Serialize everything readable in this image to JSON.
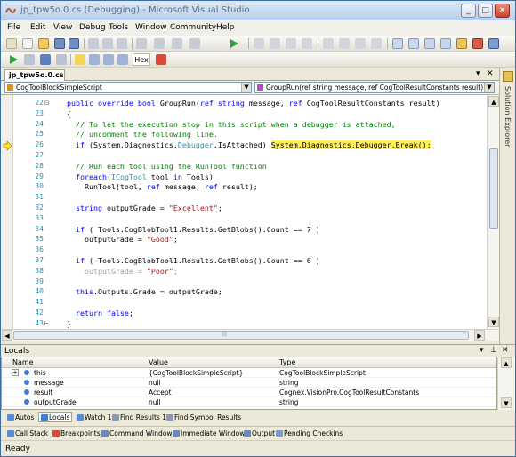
{
  "window": {
    "title": "jp_tpw5o.0.cs (Debugging) - Microsoft Visual Studio",
    "controls": {
      "minimize": "_",
      "maximize": "□",
      "close": "✕"
    }
  },
  "menu": [
    "File",
    "Edit",
    "View",
    "Debug",
    "Tools",
    "Window",
    "Community",
    "Help"
  ],
  "debug_toolbar": {
    "hex_label": "Hex"
  },
  "editor": {
    "tab_label": "jp_tpw5o.0.cs",
    "tab_controls": {
      "pin": "▾",
      "close": "✕"
    },
    "class_combo": "CogToolBlockSimpleScript",
    "member_combo": "GroupRun(ref string message, ref CogToolResultConstants result)",
    "lines": [
      {
        "num": "22",
        "fold": "⊟",
        "tokens": [
          [
            "",
            "  "
          ],
          [
            "kw",
            "public override bool "
          ],
          [
            "",
            "GroupRun("
          ],
          [
            "kw",
            "ref string "
          ],
          [
            "",
            "message, "
          ],
          [
            "kw",
            "ref "
          ],
          [
            "",
            "CogToolResultConstants result)"
          ]
        ]
      },
      {
        "num": "23",
        "fold": "",
        "tokens": [
          [
            "",
            "  {"
          ]
        ]
      },
      {
        "num": "24",
        "fold": "",
        "tokens": [
          [
            "cm",
            "    // To let the execution stop in this script when a debugger is attached,"
          ]
        ]
      },
      {
        "num": "25",
        "fold": "",
        "tokens": [
          [
            "cm",
            "    // uncomment the following line."
          ]
        ]
      },
      {
        "num": "26",
        "fold": "",
        "tokens": [
          [
            "kw",
            "    if "
          ],
          [
            "",
            "(System.Diagnostics."
          ],
          [
            "ty",
            "Debugger"
          ],
          [
            "",
            ".IsAttached) "
          ],
          [
            "hl",
            "System.Diagnostics.Debugger.Break();"
          ]
        ]
      },
      {
        "num": "27",
        "fold": "",
        "tokens": [
          [
            "",
            ""
          ]
        ]
      },
      {
        "num": "28",
        "fold": "",
        "tokens": [
          [
            "cm",
            "    // Run each tool using the RunTool function"
          ]
        ]
      },
      {
        "num": "29",
        "fold": "",
        "tokens": [
          [
            "kw",
            "    foreach"
          ],
          [
            "",
            "("
          ],
          [
            "ty",
            "ICogTool "
          ],
          [
            "",
            "tool "
          ],
          [
            "kw",
            "in "
          ],
          [
            "",
            "Tools)"
          ]
        ]
      },
      {
        "num": "30",
        "fold": "",
        "tokens": [
          [
            "",
            "      RunTool(tool, "
          ],
          [
            "kw",
            "ref "
          ],
          [
            "",
            "message, "
          ],
          [
            "kw",
            "ref "
          ],
          [
            "",
            "result);"
          ]
        ]
      },
      {
        "num": "31",
        "fold": "",
        "tokens": [
          [
            "",
            ""
          ]
        ]
      },
      {
        "num": "32",
        "fold": "",
        "tokens": [
          [
            "kw",
            "    string "
          ],
          [
            "",
            "outputGrade = "
          ],
          [
            "st",
            "\"Excellent\""
          ],
          [
            "",
            ";"
          ]
        ]
      },
      {
        "num": "33",
        "fold": "",
        "tokens": [
          [
            "",
            ""
          ]
        ]
      },
      {
        "num": "34",
        "fold": "",
        "tokens": [
          [
            "kw",
            "    if "
          ],
          [
            "",
            "( Tools.CogBlobTool1.Results.GetBlobs().Count == 7 )"
          ]
        ]
      },
      {
        "num": "35",
        "fold": "",
        "tokens": [
          [
            "",
            "      outputGrade = "
          ],
          [
            "st",
            "\"Good\""
          ],
          [
            "",
            ";"
          ]
        ]
      },
      {
        "num": "36",
        "fold": "",
        "tokens": [
          [
            "",
            ""
          ]
        ]
      },
      {
        "num": "37",
        "fold": "",
        "tokens": [
          [
            "kw",
            "    if "
          ],
          [
            "",
            "( Tools.CogBlobTool1.Results.GetBlobs().Count == 6 )"
          ]
        ]
      },
      {
        "num": "38",
        "fold": "",
        "tokens": [
          [
            "gray",
            "      outputGrade = "
          ],
          [
            "st",
            "\"Poor\""
          ],
          [
            "gray",
            ";"
          ]
        ]
      },
      {
        "num": "39",
        "fold": "",
        "tokens": [
          [
            "",
            ""
          ]
        ]
      },
      {
        "num": "40",
        "fold": "",
        "tokens": [
          [
            "kw",
            "    this"
          ],
          [
            "",
            ".Outputs.Grade = outputGrade;"
          ]
        ]
      },
      {
        "num": "41",
        "fold": "",
        "tokens": [
          [
            "",
            ""
          ]
        ]
      },
      {
        "num": "42",
        "fold": "",
        "tokens": [
          [
            "kw",
            "    return false"
          ],
          [
            "",
            ";"
          ]
        ]
      },
      {
        "num": "43",
        "fold": "⊢",
        "tokens": [
          [
            "",
            "  }"
          ]
        ]
      }
    ]
  },
  "side_panel": {
    "label": "Solution Explorer"
  },
  "locals": {
    "title": "Locals",
    "header_controls": {
      "pin": "▾",
      "autohide": "⊥",
      "close": "✕"
    },
    "columns": [
      "Name",
      "Value",
      "Type"
    ],
    "rows": [
      {
        "expander": "+",
        "name": "this",
        "value": "{CogToolBlockSimpleScript}",
        "type": "CogToolBlockSimpleScript"
      },
      {
        "expander": "",
        "name": "message",
        "value": "null",
        "type": "string"
      },
      {
        "expander": "",
        "name": "result",
        "value": "Accept",
        "type": "Cognex.VisionPro.CogToolResultConstants"
      },
      {
        "expander": "",
        "name": "outputGrade",
        "value": "null",
        "type": "string"
      }
    ]
  },
  "bottom_tabs_row1": [
    {
      "label": "Autos",
      "color": "#5b8bd0"
    },
    {
      "label": "Locals",
      "color": "#3d7bd6"
    },
    {
      "label": "Watch 1",
      "color": "#5b8bd0"
    },
    {
      "label": "Find Results 1",
      "color": "#8a98b0"
    },
    {
      "label": "Find Symbol Results",
      "color": "#8a98b0"
    }
  ],
  "bottom_tabs_row2": [
    {
      "label": "Call Stack",
      "color": "#5b8bd0"
    },
    {
      "label": "Breakpoints",
      "color": "#d84a3a"
    },
    {
      "label": "Command Window",
      "color": "#6a88b8"
    },
    {
      "label": "Immediate Window",
      "color": "#6a88b8"
    },
    {
      "label": "Output",
      "color": "#6a88b8"
    },
    {
      "label": "Pending Checkins",
      "color": "#7a9ac8"
    }
  ],
  "status": {
    "text": "Ready"
  },
  "icons": {
    "app": "vs-app-icon",
    "current_statement": "current-statement-arrow-icon"
  }
}
